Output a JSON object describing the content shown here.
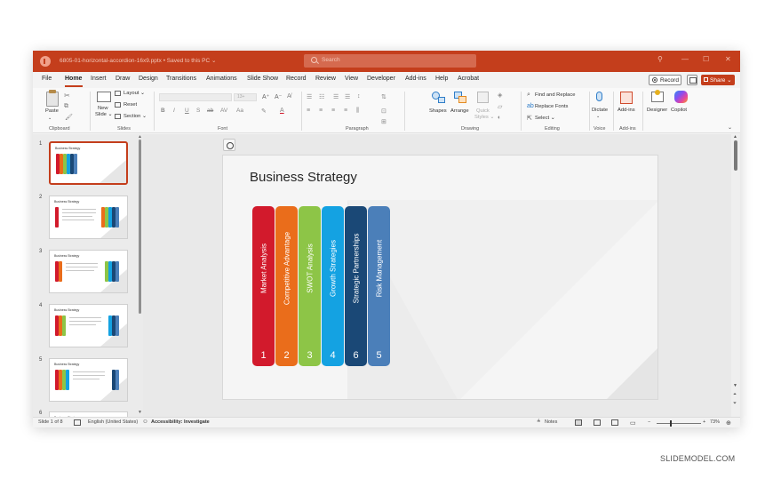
{
  "window": {
    "title": "6805-01-horizontal-accordion-16x9.pptx • Saved to this PC ⌄",
    "search_placeholder": "Search",
    "controls": [
      "⚲",
      "—",
      "☐",
      "✕"
    ]
  },
  "menu": {
    "tabs": [
      "File",
      "Home",
      "Insert",
      "Draw",
      "Design",
      "Transitions",
      "Animations",
      "Slide Show",
      "Record",
      "Review",
      "View",
      "Developer",
      "Add-ins",
      "Help",
      "Acrobat"
    ],
    "active_tab": "Home",
    "record_label": "Record",
    "share_label": "Share ⌄"
  },
  "ribbon": {
    "clipboard": {
      "paste": "Paste",
      "label": "Clipboard"
    },
    "slides": {
      "new_slide": "New",
      "new_slide2": "Slide ⌄",
      "layout": "Layout ⌄",
      "reset": "Reset",
      "section": "Section ⌄",
      "label": "Slides"
    },
    "font": {
      "label": "Font",
      "size": "13+"
    },
    "paragraph": {
      "label": "Paragraph"
    },
    "drawing": {
      "shapes": "Shapes",
      "arrange": "Arrange",
      "quick_styles": "Quick",
      "quick_styles2": "Styles ⌄",
      "label": "Drawing"
    },
    "editing": {
      "find_replace": "Find and Replace",
      "replace_fonts": "Replace Fonts",
      "select": "Select ⌄",
      "label": "Editing"
    },
    "voice": {
      "dictate": "Dictate",
      "label": "Voice"
    },
    "addins": {
      "addins": "Add-ins",
      "label": "Add-ins"
    },
    "designer": "Designer",
    "copilot": "Copilot"
  },
  "thumbnails": {
    "numbers": [
      "1",
      "2",
      "3",
      "4",
      "5",
      "6"
    ],
    "title": "Business Strategy",
    "selected": 1
  },
  "slide": {
    "title": "Business Strategy",
    "panels": [
      {
        "label": "Market Analysis",
        "number": "1",
        "color": "#d21a2c"
      },
      {
        "label": "Competitive Advantage",
        "number": "2",
        "color": "#ea6d1b"
      },
      {
        "label": "SWOT Analysis",
        "number": "3",
        "color": "#8dc547"
      },
      {
        "label": "Growth Strategies",
        "number": "4",
        "color": "#14a2e2"
      },
      {
        "label": "Strategic Partnerships",
        "number": "6",
        "color": "#1a4876"
      },
      {
        "label": "Risk Management",
        "number": "5",
        "color": "#4b7fb9"
      }
    ]
  },
  "status": {
    "slide_of": "Slide 1 of 8",
    "language": "English (United States)",
    "accessibility": "Accessibility: Investigate",
    "notes": "Notes",
    "zoom": "73%"
  },
  "watermark": "SLIDEMODEL.COM"
}
